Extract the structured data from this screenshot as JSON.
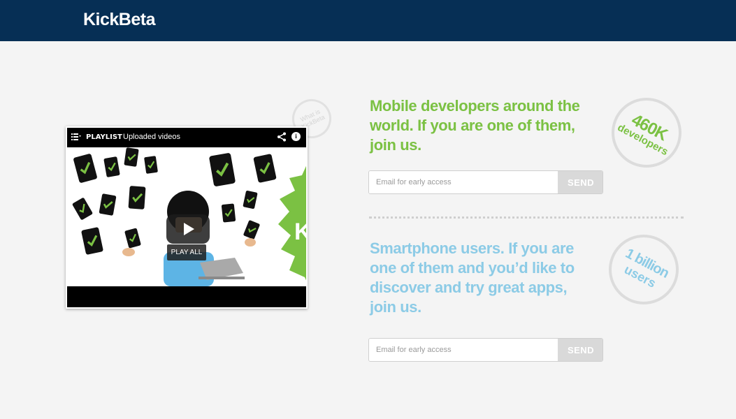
{
  "header": {
    "logo": "KickBeta"
  },
  "badge": {
    "text": "What is KickBeta"
  },
  "video": {
    "playlist_label": "PLAYLIST",
    "title": "Uploaded videos",
    "play_all_label": "PLAY ALL",
    "frame_letters": "Ki"
  },
  "developers": {
    "headline": "Mobile developers around the world. If you are one of them, join us.",
    "stat_number": "460K",
    "stat_unit": "developers",
    "email_placeholder": "Email for early access",
    "send_label": "SEND"
  },
  "users": {
    "headline": "Smartphone users. If you are one of them and you’d like to discover and try great apps, join us.",
    "stat_number": "1 billion",
    "stat_unit": "users",
    "email_placeholder": "Email for early access",
    "send_label": "SEND"
  },
  "colors": {
    "header_bg": "#062f55",
    "developer_green": "#7bc143",
    "user_blue": "#8ccbe6",
    "send_button": "#d9d9d9"
  }
}
